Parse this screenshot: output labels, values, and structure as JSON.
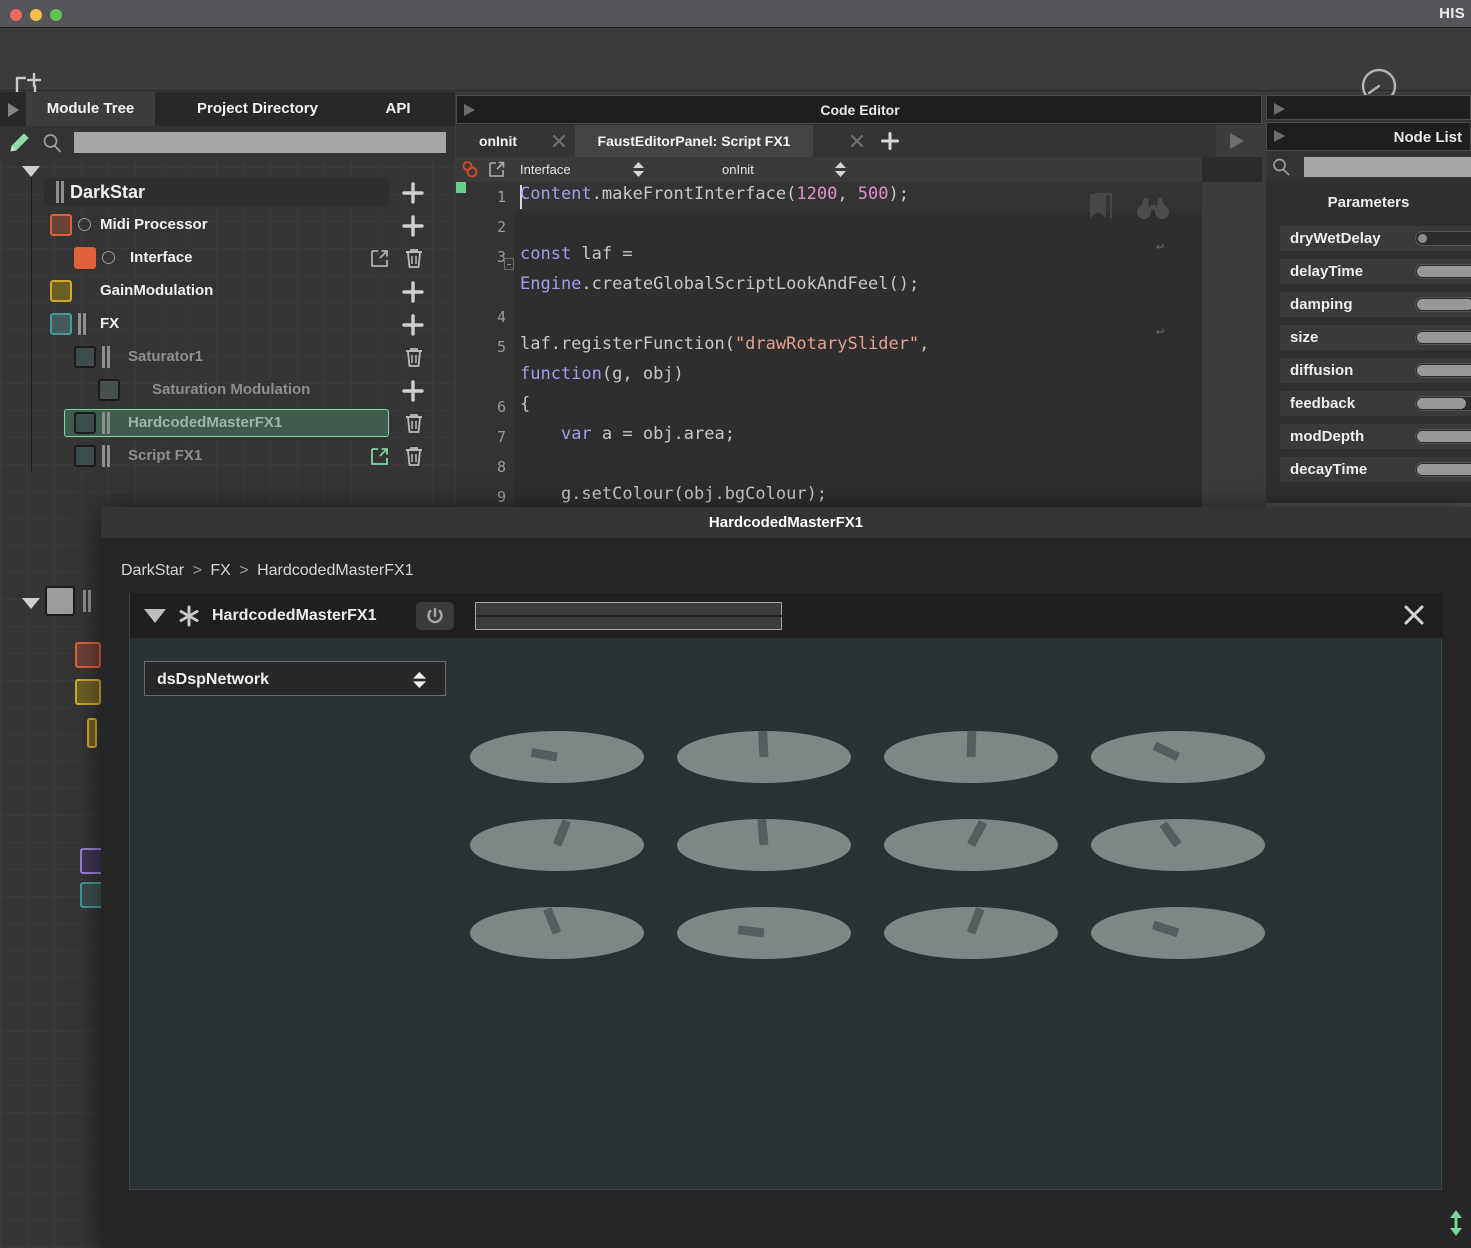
{
  "window": {
    "title": "HIS",
    "traffic_lights": [
      "close",
      "minimize",
      "zoom"
    ]
  },
  "toolbar": {
    "new_project_icon": "new-window-icon",
    "master_knob_icon": "master-knob-icon"
  },
  "left_panel": {
    "tabs": [
      {
        "label": "Module Tree",
        "selected": true
      },
      {
        "label": "Project Directory",
        "selected": false
      },
      {
        "label": "API",
        "selected": false
      }
    ],
    "search_placeholder": "",
    "search_value": "",
    "tree": [
      {
        "label": "DarkStar",
        "depth": 0,
        "color": "#8c8c8c",
        "dim": false,
        "selected": false,
        "has_plus": true,
        "has_trash": false,
        "has_popout": false,
        "icon": "dual-bar",
        "swatch": false
      },
      {
        "label": "Midi Processor",
        "depth": 1,
        "color": "#6a4236",
        "dim": false,
        "selected": false,
        "has_plus": true,
        "has_trash": false,
        "has_popout": false,
        "icon": "knob-dot",
        "swatch": true,
        "border": "#e0603a"
      },
      {
        "label": "Interface",
        "depth": 2,
        "color": "#e0603a",
        "dim": false,
        "selected": false,
        "has_plus": false,
        "has_trash": true,
        "has_popout": true,
        "icon": "knob-dot",
        "swatch": true,
        "border": "#e0603a"
      },
      {
        "label": "GainModulation",
        "depth": 1,
        "color": "#6c5f24",
        "dim": false,
        "selected": false,
        "has_plus": true,
        "has_trash": false,
        "has_popout": false,
        "icon": "none",
        "swatch": true,
        "border": "#d1a82b"
      },
      {
        "label": "FX",
        "depth": 1,
        "color": "#46595b",
        "dim": false,
        "selected": false,
        "has_plus": true,
        "has_trash": false,
        "has_popout": false,
        "icon": "dual-bar",
        "swatch": true,
        "border": "#3f9a9c"
      },
      {
        "label": "Saturator1",
        "depth": 2,
        "color": "#3b4d4d",
        "dim": true,
        "selected": false,
        "has_plus": false,
        "has_trash": true,
        "has_popout": false,
        "icon": "dual-bar",
        "swatch": true,
        "border": "#1b1b1b"
      },
      {
        "label": "Saturation Modulation",
        "depth": 3,
        "color": "#44514f",
        "dim": true,
        "selected": false,
        "has_plus": true,
        "has_trash": false,
        "has_popout": false,
        "icon": "none",
        "swatch": true,
        "border": "#1b1b1b"
      },
      {
        "label": "HardcodedMasterFX1",
        "depth": 2,
        "color": "#3b4d4d",
        "dim": true,
        "selected": true,
        "has_plus": false,
        "has_trash": true,
        "has_popout": false,
        "icon": "dual-bar",
        "swatch": true,
        "border": "#1b1b1b"
      },
      {
        "label": "Script FX1",
        "depth": 2,
        "color": "#3b4d4d",
        "dim": true,
        "selected": false,
        "has_plus": false,
        "has_trash": true,
        "has_popout": true,
        "icon": "dual-bar",
        "swatch": true,
        "border": "#1b1b1b"
      }
    ],
    "selection_color": "#7fd8a0"
  },
  "code_editor": {
    "panel_title": "Code Editor",
    "tabs": [
      {
        "label": "onInit",
        "active": false,
        "closable": true
      },
      {
        "label": "FaustEditorPanel: Script FX1",
        "active": true,
        "closable": true
      }
    ],
    "add_tab_icon": "plus-icon",
    "run_icon": "play-icon",
    "selectors": [
      {
        "label": "Interface"
      },
      {
        "label": "onInit"
      }
    ],
    "gutter_icons": [
      "chain-link-icon",
      "popout-icon"
    ],
    "right_icons": [
      "bookmark-icon",
      "binoculars-icon"
    ],
    "lines": [
      {
        "num": "1",
        "segments": [
          {
            "t": "Content",
            "c": "k-obj"
          },
          {
            "t": ".makeFrontInterface(",
            "c": ""
          },
          {
            "t": "1200",
            "c": "k-num"
          },
          {
            "t": ", ",
            "c": ""
          },
          {
            "t": "500",
            "c": "k-num"
          },
          {
            "t": ");",
            "c": ""
          }
        ]
      },
      {
        "num": "2",
        "segments": []
      },
      {
        "num": "3",
        "segments": [
          {
            "t": "const",
            "c": "k-kw"
          },
          {
            "t": " laf =",
            "c": ""
          }
        ]
      },
      {
        "num": "",
        "segments": [
          {
            "t": "Engine",
            "c": "k-obj"
          },
          {
            "t": ".createGlobalScriptLookAndFeel();",
            "c": ""
          }
        ]
      },
      {
        "num": "4",
        "segments": []
      },
      {
        "num": "5",
        "segments": [
          {
            "t": "laf.registerFunction(",
            "c": ""
          },
          {
            "t": "\"drawRotarySlider\"",
            "c": "k-str"
          },
          {
            "t": ",",
            "c": ""
          }
        ]
      },
      {
        "num": "",
        "segments": [
          {
            "t": "function",
            "c": "k-kw"
          },
          {
            "t": "(g, obj)",
            "c": ""
          }
        ]
      },
      {
        "num": "6",
        "segments": [
          {
            "t": "{",
            "c": ""
          }
        ]
      },
      {
        "num": "7",
        "segments": [
          {
            "t": "    ",
            "c": ""
          },
          {
            "t": "var",
            "c": "k-kw"
          },
          {
            "t": " a = obj.area;",
            "c": ""
          }
        ]
      },
      {
        "num": "8",
        "segments": []
      },
      {
        "num": "9",
        "segments": [
          {
            "t": "    g.setColour(obj.bgColour);",
            "c": ""
          }
        ]
      }
    ]
  },
  "right_panel": {
    "node_list_title": "Node List",
    "search_value": "",
    "params_title": "Parameters",
    "parameters": [
      {
        "name": "dryWetDelay",
        "fill": 0.0
      },
      {
        "name": "delayTime",
        "fill": 0.86
      },
      {
        "name": "damping",
        "fill": 0.8
      },
      {
        "name": "size",
        "fill": 0.93
      },
      {
        "name": "diffusion",
        "fill": 0.97
      },
      {
        "name": "feedback",
        "fill": 0.7
      },
      {
        "name": "modDepth",
        "fill": 0.95
      },
      {
        "name": "decayTime",
        "fill": 0.93
      }
    ]
  },
  "dialog": {
    "title": "HardcodedMasterFX1",
    "breadcrumb": [
      "DarkStar",
      ">",
      "FX",
      ">",
      "HardcodedMasterFX1"
    ],
    "module": {
      "name": "HardcodedMasterFX1",
      "power_icon": "power-icon",
      "star_icon": "snowflake-icon",
      "collapse_icon": "caret-down-icon",
      "close_icon": "close-icon",
      "meter_value": 0
    },
    "network_select": {
      "value": "dsDspNetwork",
      "stepper_icon": "up-down-icon"
    },
    "knobs": [
      {
        "angle": -80
      },
      {
        "angle": -3
      },
      {
        "angle": 2
      },
      {
        "angle": -64
      },
      {
        "angle": 22
      },
      {
        "angle": -5
      },
      {
        "angle": 28
      },
      {
        "angle": -35
      },
      {
        "angle": -22
      },
      {
        "angle": -83
      },
      {
        "angle": 21
      },
      {
        "angle": -72
      }
    ],
    "knob_columns": 4,
    "knob_rows": 3
  },
  "resize_grip_icon": "resize-vertical-icon",
  "colors": {
    "accent_green": "#7fd8a0",
    "panel_bg": "#333333",
    "dialog_bg": "#262626",
    "fx_bg": "#2a3133",
    "knob_cap": "#7c8786",
    "knob_pointer": "#555e5e"
  }
}
